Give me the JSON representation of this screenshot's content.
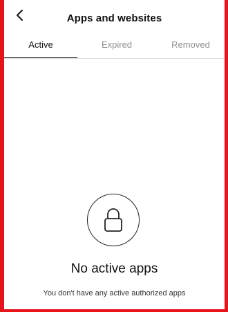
{
  "header": {
    "back_icon": "chevron-left-icon",
    "title": "Apps and websites"
  },
  "tabs": [
    {
      "label": "Active",
      "selected": true
    },
    {
      "label": "Expired",
      "selected": false
    },
    {
      "label": "Removed",
      "selected": false
    }
  ],
  "empty_state": {
    "icon": "lock-icon",
    "title": "No active apps",
    "subtitle": "You don't have any active authorized apps"
  },
  "colors": {
    "frame_border": "#e8141c",
    "text_primary": "#111111",
    "text_muted": "#8e8e8e"
  }
}
